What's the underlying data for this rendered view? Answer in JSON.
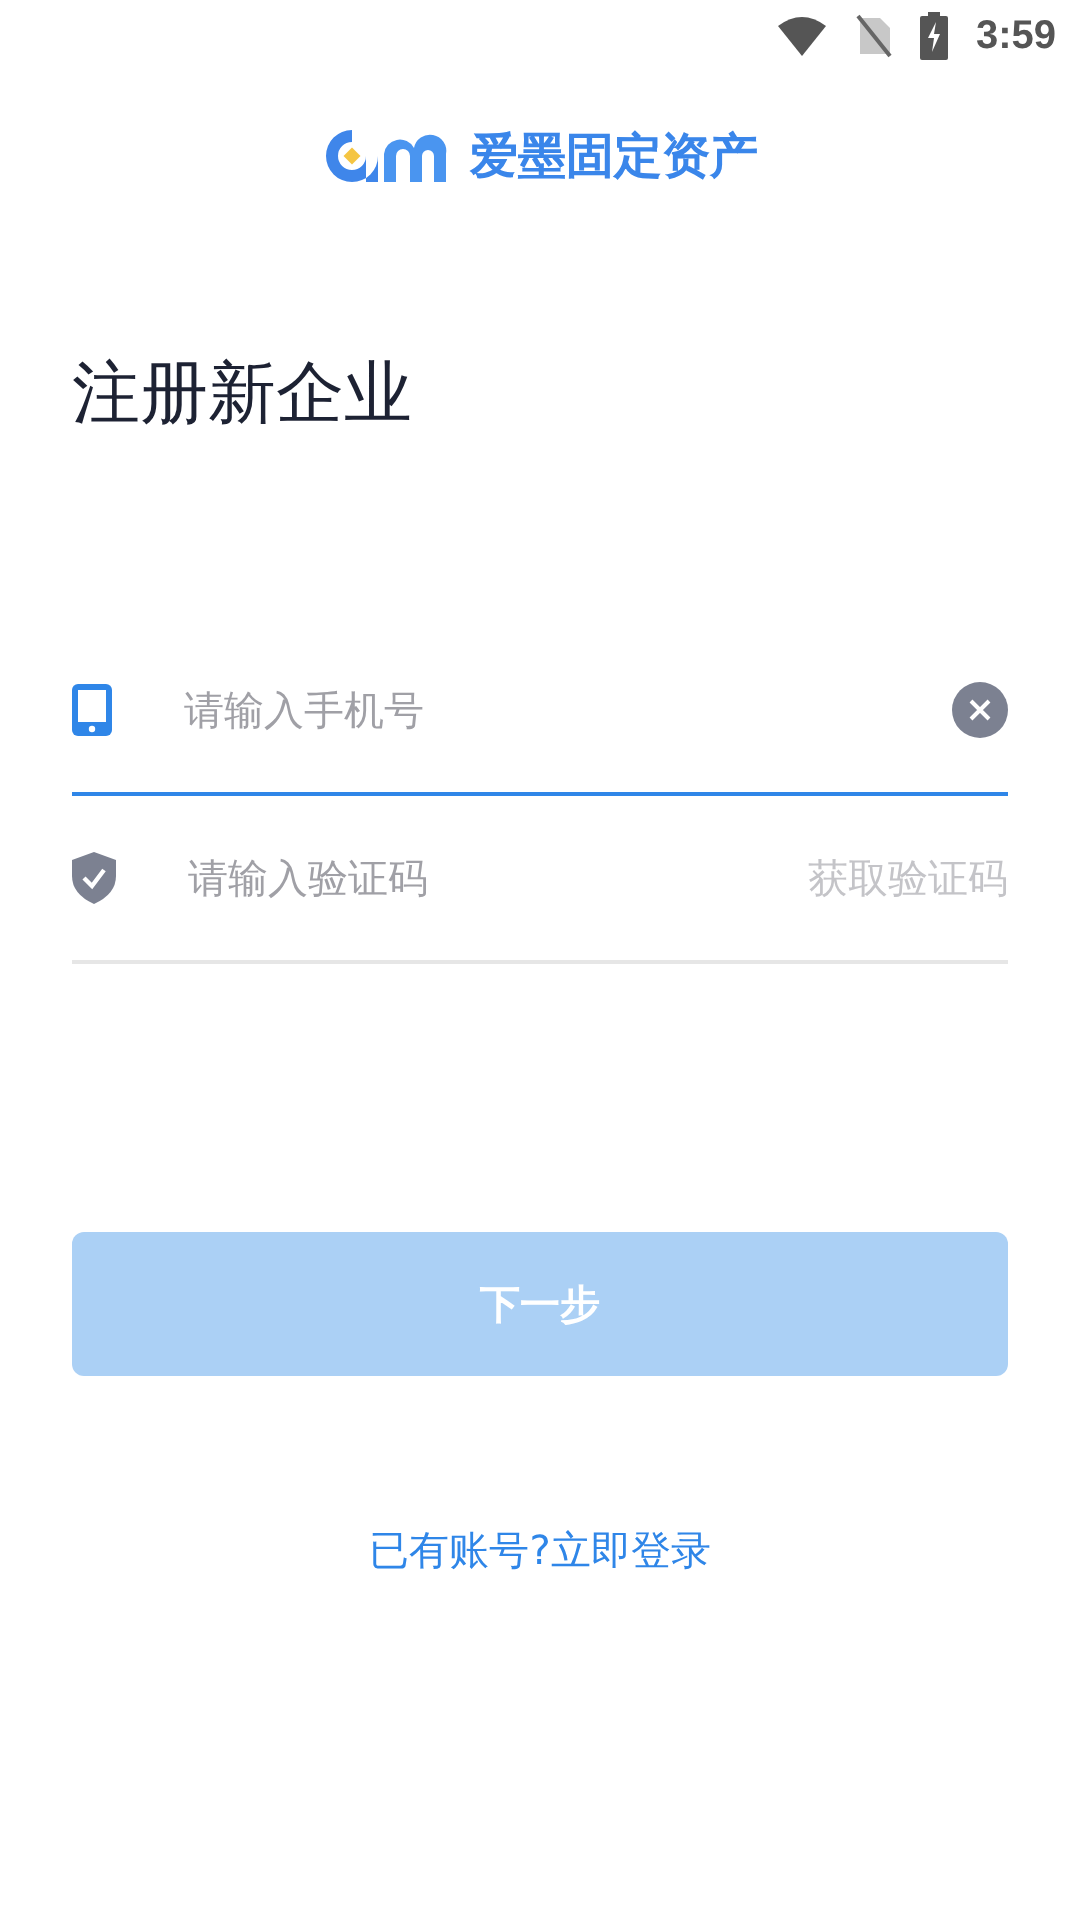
{
  "status_bar": {
    "time": "3:59"
  },
  "brand": {
    "name": "爱墨固定资产"
  },
  "title": "注册新企业",
  "fields": [
    {
      "kind": "phone",
      "placeholder": "请输入手机号",
      "focused": true
    },
    {
      "kind": "code",
      "placeholder": "请输入验证码",
      "focused": false,
      "action": "获取验证码"
    }
  ],
  "next_button": {
    "label": "下一步",
    "disabled": true
  },
  "login_link": "已有账号?立即登录"
}
